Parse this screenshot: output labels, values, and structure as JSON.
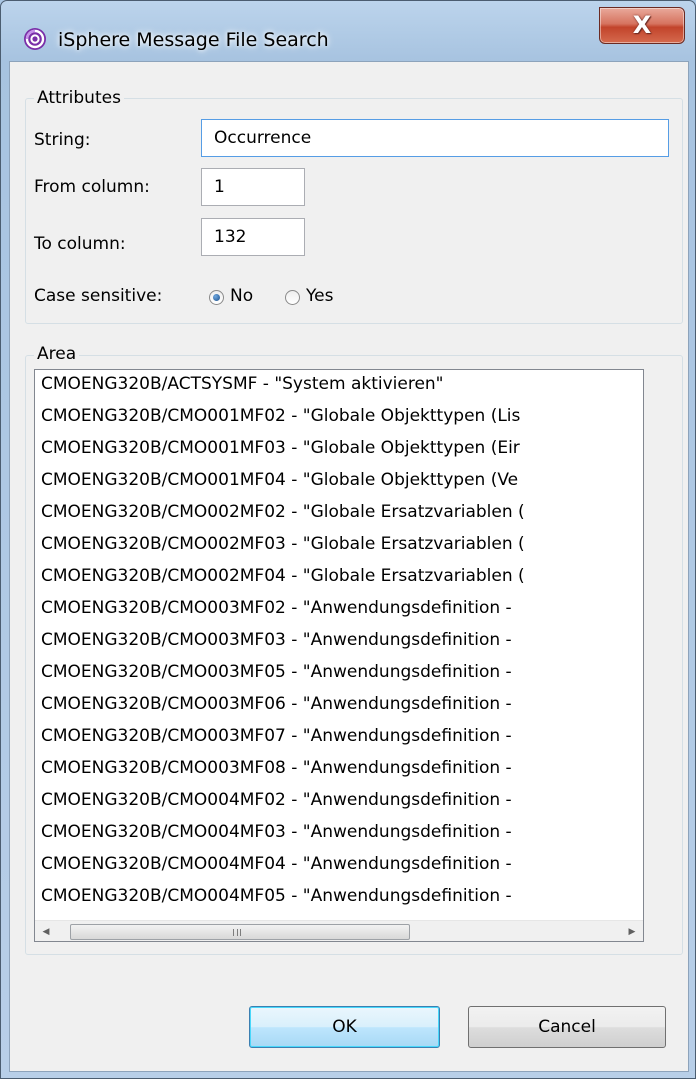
{
  "window": {
    "title": "iSphere Message File Search",
    "close_glyph": "X",
    "app_icon": "isphere-logo-icon",
    "close_icon": "close-icon"
  },
  "attributes": {
    "legend": "Attributes",
    "string_label": "String:",
    "string_value": "Occurrence",
    "from_column_label": "From column:",
    "from_column_value": "1",
    "to_column_label": "To column:",
    "to_column_value": "132",
    "case_sensitive_label": "Case sensitive:",
    "case_no_label": "No",
    "case_yes_label": "Yes",
    "case_selected": "No"
  },
  "area": {
    "legend": "Area",
    "items": [
      "CMOENG320B/ACTSYSMF - \"System aktivieren\"",
      "CMOENG320B/CMO001MF02 - \"Globale Objekttypen (Lis",
      "CMOENG320B/CMO001MF03 - \"Globale Objekttypen (Eir",
      "CMOENG320B/CMO001MF04 - \"Globale Objekttypen (Ve",
      "CMOENG320B/CMO002MF02 - \"Globale Ersatzvariablen (",
      "CMOENG320B/CMO002MF03 - \"Globale Ersatzvariablen (",
      "CMOENG320B/CMO002MF04 - \"Globale Ersatzvariablen (",
      "CMOENG320B/CMO003MF02 - \"Anwendungsdefinition -",
      "CMOENG320B/CMO003MF03 - \"Anwendungsdefinition -",
      "CMOENG320B/CMO003MF05 - \"Anwendungsdefinition -",
      "CMOENG320B/CMO003MF06 - \"Anwendungsdefinition -",
      "CMOENG320B/CMO003MF07 - \"Anwendungsdefinition -",
      "CMOENG320B/CMO003MF08 - \"Anwendungsdefinition -",
      "CMOENG320B/CMO004MF02 - \"Anwendungsdefinition -",
      "CMOENG320B/CMO004MF03 - \"Anwendungsdefinition -",
      "CMOENG320B/CMO004MF04 - \"Anwendungsdefinition -",
      "CMOENG320B/CMO004MF05 - \"Anwendungsdefinition -"
    ],
    "hscroll_grip": "III"
  },
  "buttons": {
    "ok_label": "OK",
    "cancel_label": "Cancel"
  },
  "colors": {
    "frame": "#b8cfe8",
    "client": "#f0f0f0",
    "close_red": "#c2442b",
    "default_button": "#a7d9f5"
  }
}
